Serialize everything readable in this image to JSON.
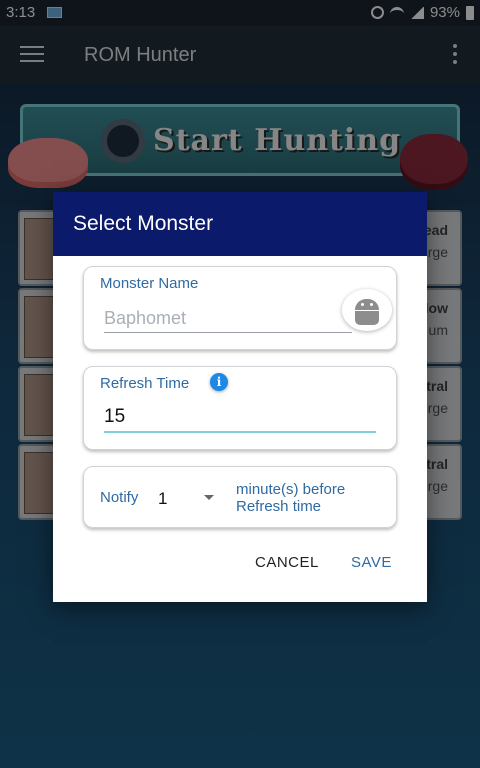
{
  "status_bar": {
    "time": "3:13",
    "battery": "93%"
  },
  "app_bar": {
    "title": "ROM Hunter"
  },
  "banner": {
    "label": "Start Hunting"
  },
  "background_cards": [
    {
      "line1": "ead",
      "line2": "rge"
    },
    {
      "line1": "low",
      "line2": "um"
    },
    {
      "line1": "tral",
      "line2": "rge"
    },
    {
      "line1": "tral",
      "line2": "rge"
    }
  ],
  "dialog": {
    "title": "Select Monster",
    "monster_name": {
      "label": "Monster Name",
      "placeholder": "Baphomet",
      "value": ""
    },
    "refresh_time": {
      "label": "Refresh Time",
      "info_glyph": "i",
      "value": "15"
    },
    "notify": {
      "label": "Notify",
      "value": "1",
      "suffix": "minute(s) before Refresh time"
    },
    "buttons": {
      "cancel": "CANCEL",
      "save": "SAVE"
    }
  },
  "colors": {
    "header": "#0b1a6b",
    "accent": "#2f6aa3",
    "info": "#1e88e5"
  },
  "icons": {
    "menu": "hamburger-icon",
    "overflow": "more-vert-icon",
    "picker": "android-icon",
    "info": "info-icon"
  }
}
